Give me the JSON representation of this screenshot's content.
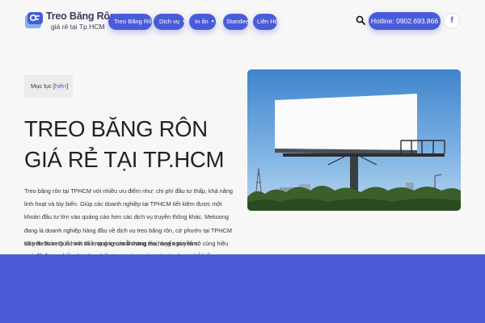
{
  "logo": {
    "title": "Treo Băng Rôn",
    "subtitle": "giá rẻ tại Tp.HCM"
  },
  "nav": {
    "items": [
      {
        "label": "Treo Băng Rôn",
        "has_caret": false
      },
      {
        "label": "Dịch vụ",
        "has_caret": true
      },
      {
        "label": "In ấn",
        "has_caret": true
      },
      {
        "label": "Standee",
        "has_caret": false
      },
      {
        "label": "Liên Hệ",
        "has_caret": false
      }
    ]
  },
  "header": {
    "hotline_label": "Hotline: 0902.693.866",
    "facebook_glyph": "f"
  },
  "toc": {
    "label": "Mục lục",
    "toggle": "hiện"
  },
  "article": {
    "title_line1": "TREO BĂNG RÔN",
    "title_line2": "GIÁ RẺ TẠI TP.HCM",
    "paragraph1": "Treo băng rôn tại TPHCM với nhiều ưu điểm như: chi phí đầu tư thấp, khả năng linh hoạt và tùy biến. Giúp các doanh nghiệp tại TPHCM tiết kiệm được một khoản đầu tư lớn vào quảng cáo hơn các dịch vụ truyền thông khác. Mekoong đang là doanh nghiệp hàng đầu về dịch vụ treo băng rôn, cờ phướn tại TPHCM và trên Toàn Quốc với số lượng treo mỗi tháng lên hàng ngàn tấm.",
    "paragraph2_pre": "Đây được xem là hình thức ",
    "paragraph2_link": "quảng cáo thương mại",
    "paragraph2_post": ", tuyến truyền vô cùng hiệu quả đã được nhiều doanh nghiệp trong và ngoài nước áp dụng phổ biến."
  },
  "colors": {
    "brand": "#4a5bd9",
    "background": "#f7f7f7",
    "text": "#222222"
  }
}
